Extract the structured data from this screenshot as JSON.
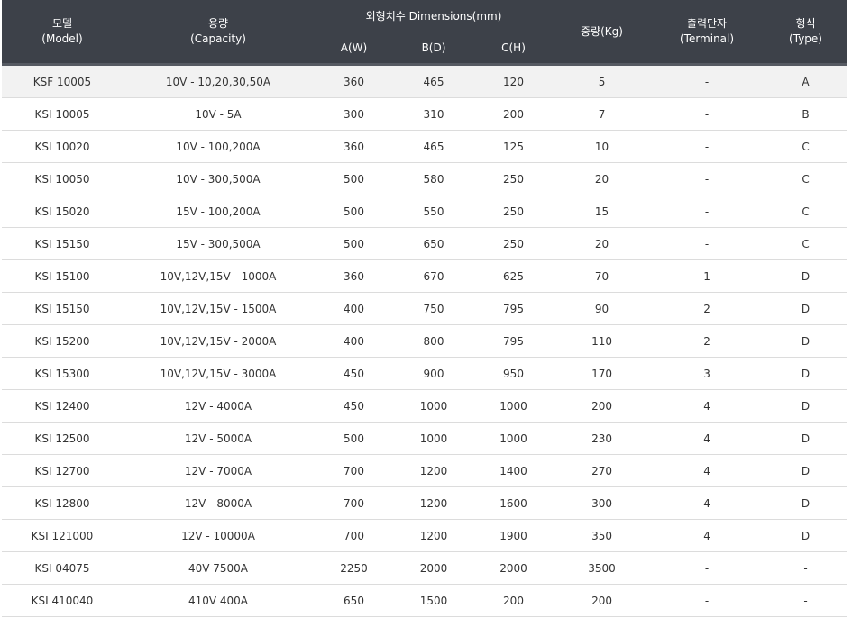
{
  "headers": {
    "model": {
      "ko": "모델",
      "en": "(Model)"
    },
    "capacity": {
      "ko": "용량",
      "en": "(Capacity)"
    },
    "dimensions": "외형치수 Dimensions(mm)",
    "dim_a": "A(W)",
    "dim_b": "B(D)",
    "dim_c": "C(H)",
    "weight": "중량(Kg)",
    "terminal": {
      "ko": "출력단자",
      "en": "(Terminal)"
    },
    "type": {
      "ko": "형식",
      "en": "(Type)"
    }
  },
  "rows": [
    {
      "model": "KSF 10005",
      "capacity": "10V - 10,20,30,50A",
      "a": "360",
      "b": "465",
      "c": "120",
      "weight": "5",
      "terminal": "-",
      "type": "A"
    },
    {
      "model": "KSI 10005",
      "capacity": "10V - 5A",
      "a": "300",
      "b": "310",
      "c": "200",
      "weight": "7",
      "terminal": "-",
      "type": "B"
    },
    {
      "model": "KSI 10020",
      "capacity": "10V - 100,200A",
      "a": "360",
      "b": "465",
      "c": "125",
      "weight": "10",
      "terminal": "-",
      "type": "C"
    },
    {
      "model": "KSI 10050",
      "capacity": "10V - 300,500A",
      "a": "500",
      "b": "580",
      "c": "250",
      "weight": "20",
      "terminal": "-",
      "type": "C"
    },
    {
      "model": "KSI 15020",
      "capacity": "15V - 100,200A",
      "a": "500",
      "b": "550",
      "c": "250",
      "weight": "15",
      "terminal": "-",
      "type": "C"
    },
    {
      "model": "KSI 15150",
      "capacity": "15V - 300,500A",
      "a": "500",
      "b": "650",
      "c": "250",
      "weight": "20",
      "terminal": "-",
      "type": "C"
    },
    {
      "model": "KSI 15100",
      "capacity": "10V,12V,15V - 1000A",
      "a": "360",
      "b": "670",
      "c": "625",
      "weight": "70",
      "terminal": "1",
      "type": "D"
    },
    {
      "model": "KSI 15150",
      "capacity": "10V,12V,15V - 1500A",
      "a": "400",
      "b": "750",
      "c": "795",
      "weight": "90",
      "terminal": "2",
      "type": "D"
    },
    {
      "model": "KSI 15200",
      "capacity": "10V,12V,15V - 2000A",
      "a": "400",
      "b": "800",
      "c": "795",
      "weight": "110",
      "terminal": "2",
      "type": "D"
    },
    {
      "model": "KSI 15300",
      "capacity": "10V,12V,15V - 3000A",
      "a": "450",
      "b": "900",
      "c": "950",
      "weight": "170",
      "terminal": "3",
      "type": "D"
    },
    {
      "model": "KSI 12400",
      "capacity": "12V - 4000A",
      "a": "450",
      "b": "1000",
      "c": "1000",
      "weight": "200",
      "terminal": "4",
      "type": "D"
    },
    {
      "model": "KSI 12500",
      "capacity": "12V - 5000A",
      "a": "500",
      "b": "1000",
      "c": "1000",
      "weight": "230",
      "terminal": "4",
      "type": "D"
    },
    {
      "model": "KSI 12700",
      "capacity": "12V - 7000A",
      "a": "700",
      "b": "1200",
      "c": "1400",
      "weight": "270",
      "terminal": "4",
      "type": "D"
    },
    {
      "model": "KSI 12800",
      "capacity": "12V - 8000A",
      "a": "700",
      "b": "1200",
      "c": "1600",
      "weight": "300",
      "terminal": "4",
      "type": "D"
    },
    {
      "model": "KSI 121000",
      "capacity": "12V - 10000A",
      "a": "700",
      "b": "1200",
      "c": "1900",
      "weight": "350",
      "terminal": "4",
      "type": "D"
    },
    {
      "model": "KSI 04075",
      "capacity": "40V 7500A",
      "a": "2250",
      "b": "2000",
      "c": "2000",
      "weight": "3500",
      "terminal": "-",
      "type": "-"
    },
    {
      "model": "KSI 410040",
      "capacity": "410V 400A",
      "a": "650",
      "b": "1500",
      "c": "200",
      "weight": "200",
      "terminal": "-",
      "type": "-"
    }
  ]
}
